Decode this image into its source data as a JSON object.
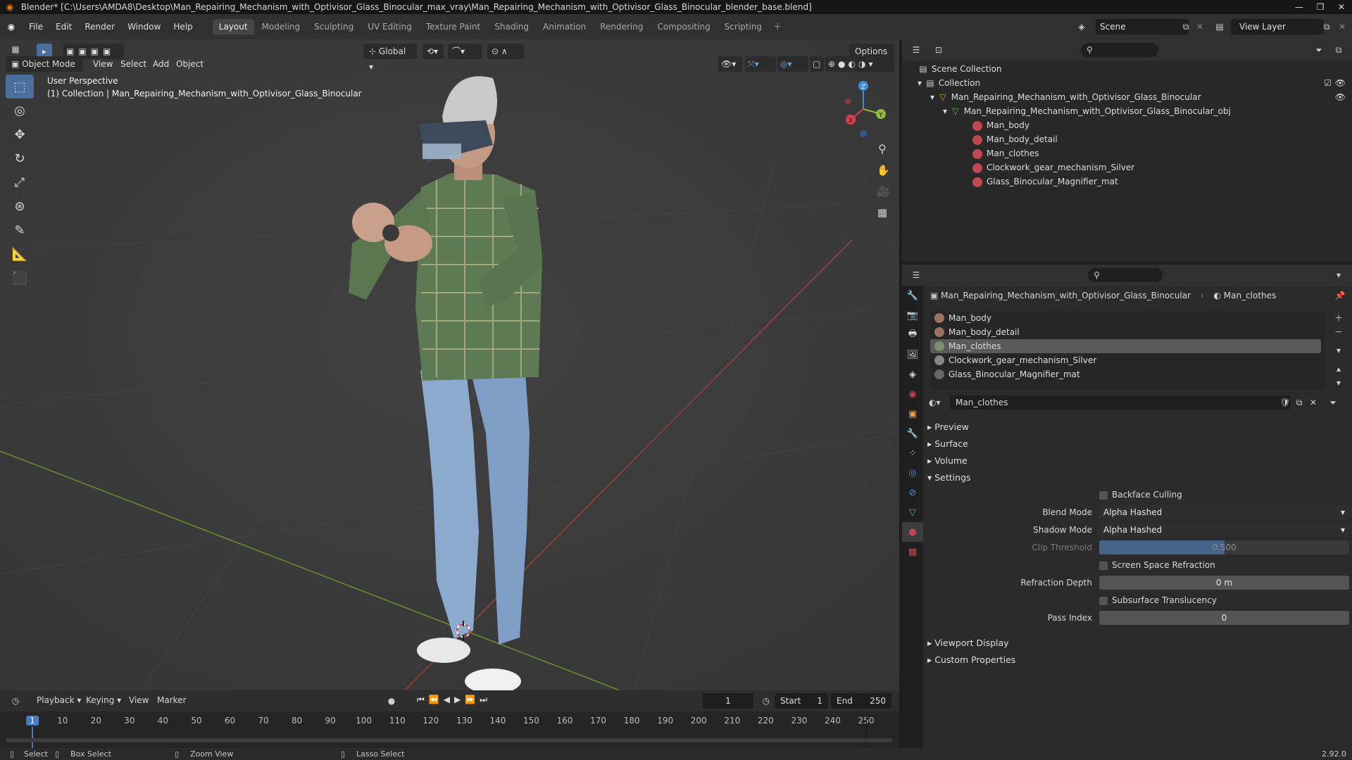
{
  "titlebar": {
    "text": "Blender* [C:\\Users\\AMDA8\\Desktop\\Man_Repairing_Mechanism_with_Optivisor_Glass_Binocular_max_vray\\Man_Repairing_Mechanism_with_Optivisor_Glass_Binocular_blender_base.blend]"
  },
  "menu": [
    "File",
    "Edit",
    "Render",
    "Window",
    "Help"
  ],
  "workspaces": [
    "Layout",
    "Modeling",
    "Sculpting",
    "UV Editing",
    "Texture Paint",
    "Shading",
    "Animation",
    "Rendering",
    "Compositing",
    "Scripting"
  ],
  "active_workspace": "Layout",
  "scene": {
    "scene_name": "Scene",
    "view_layer": "View Layer"
  },
  "viewport": {
    "mode": "Object Mode",
    "menus": [
      "View",
      "Select",
      "Add",
      "Object"
    ],
    "transform_orientation": "Global",
    "options_label": "Options",
    "perspective_label": "User Perspective",
    "collection_label": "(1) Collection | Man_Repairing_Mechanism_with_Optivisor_Glass_Binocular",
    "gizmo_axes": {
      "x": "X",
      "y": "Y",
      "z": "Z"
    }
  },
  "timeline": {
    "menus": [
      "Playback",
      "Keying",
      "View",
      "Marker"
    ],
    "current_frame": "1",
    "start_label": "Start",
    "start_value": "1",
    "end_label": "End",
    "end_value": "250",
    "ruler": [
      "1",
      "10",
      "20",
      "30",
      "40",
      "50",
      "60",
      "70",
      "80",
      "90",
      "100",
      "110",
      "120",
      "130",
      "140",
      "150",
      "160",
      "170",
      "180",
      "190",
      "200",
      "210",
      "220",
      "230",
      "240",
      "250"
    ]
  },
  "statusbar": {
    "select": "Select",
    "box_select": "Box Select",
    "zoom_view": "Zoom View",
    "lasso_select": "Lasso Select",
    "version": "2.92.0"
  },
  "outliner": {
    "scene_collection": "Scene Collection",
    "collection": "Collection",
    "object": "Man_Repairing_Mechanism_with_Optivisor_Glass_Binocular",
    "mesh": "Man_Repairing_Mechanism_with_Optivisor_Glass_Binocular_obj",
    "materials": [
      "Man_body",
      "Man_body_detail",
      "Man_clothes",
      "Clockwork_gear_mechanism_Silver",
      "Glass_Binocular_Magnifier_mat"
    ]
  },
  "properties": {
    "breadcrumb_object": "Man_Repairing_Mechanism_with_Optivisor_Glass_Binocular",
    "breadcrumb_material": "Man_clothes",
    "material_slots": [
      "Man_body",
      "Man_body_detail",
      "Man_clothes",
      "Clockwork_gear_mechanism_Silver",
      "Glass_Binocular_Magnifier_mat"
    ],
    "active_slot_index": 2,
    "material_name": "Man_clothes",
    "panels": {
      "preview": "Preview",
      "surface": "Surface",
      "volume": "Volume",
      "settings": "Settings",
      "viewport_display": "Viewport Display",
      "custom_properties": "Custom Properties"
    },
    "settings": {
      "backface_culling": "Backface Culling",
      "blend_mode_label": "Blend Mode",
      "blend_mode_value": "Alpha Hashed",
      "shadow_mode_label": "Shadow Mode",
      "shadow_mode_value": "Alpha Hashed",
      "clip_threshold_label": "Clip Threshold",
      "clip_threshold_value": "0.500",
      "screen_space_refraction": "Screen Space Refraction",
      "refraction_depth_label": "Refraction Depth",
      "refraction_depth_value": "0 m",
      "subsurface_translucency": "Subsurface Translucency",
      "pass_index_label": "Pass Index",
      "pass_index_value": "0"
    }
  },
  "colors": {
    "accent": "#4a6f9e",
    "viewport_bg": "#3a3a3a",
    "x_axis": "#d9414b",
    "y_axis": "#8fbf32",
    "z_axis": "#3b8de0"
  }
}
